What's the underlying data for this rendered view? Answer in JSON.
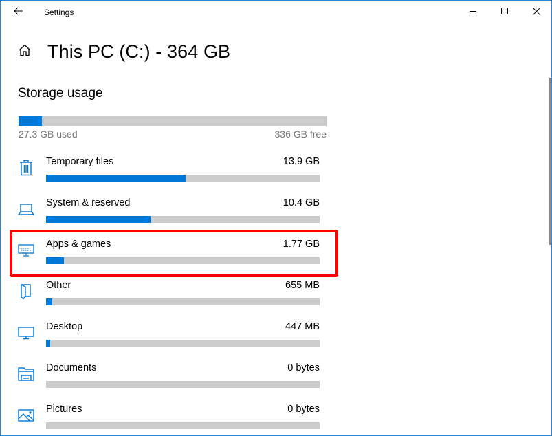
{
  "window": {
    "app_title": "Settings",
    "controls": {
      "minimize": "minimize-icon",
      "maximize": "maximize-icon",
      "close": "close-icon"
    },
    "back_icon": "arrow-left-icon"
  },
  "header": {
    "home_icon": "home-icon",
    "title": "This PC (C:) - 364 GB"
  },
  "storage": {
    "section_title": "Storage usage",
    "used_label": "27.3 GB used",
    "free_label": "336 GB free",
    "used_fraction": 0.075,
    "accent_color": "#0078d7",
    "track_color": "#cccccc"
  },
  "items": [
    {
      "name": "Temporary files",
      "size": "13.9 GB",
      "icon": "trash-icon",
      "fraction": 0.51
    },
    {
      "name": "System & reserved",
      "size": "10.4 GB",
      "icon": "laptop-icon",
      "fraction": 0.382
    },
    {
      "name": "Apps & games",
      "size": "1.77 GB",
      "icon": "keyboard-monitor-icon",
      "fraction": 0.065
    },
    {
      "name": "Other",
      "size": "655 MB",
      "icon": "other-document-icon",
      "fraction": 0.023
    },
    {
      "name": "Desktop",
      "size": "447 MB",
      "icon": "monitor-icon",
      "fraction": 0.015
    },
    {
      "name": "Documents",
      "size": "0 bytes",
      "icon": "documents-folder-icon",
      "fraction": 0
    },
    {
      "name": "Pictures",
      "size": "0 bytes",
      "icon": "pictures-icon",
      "fraction": 0
    }
  ],
  "highlight": {
    "target": "Apps & games",
    "color": "#ff0000"
  }
}
